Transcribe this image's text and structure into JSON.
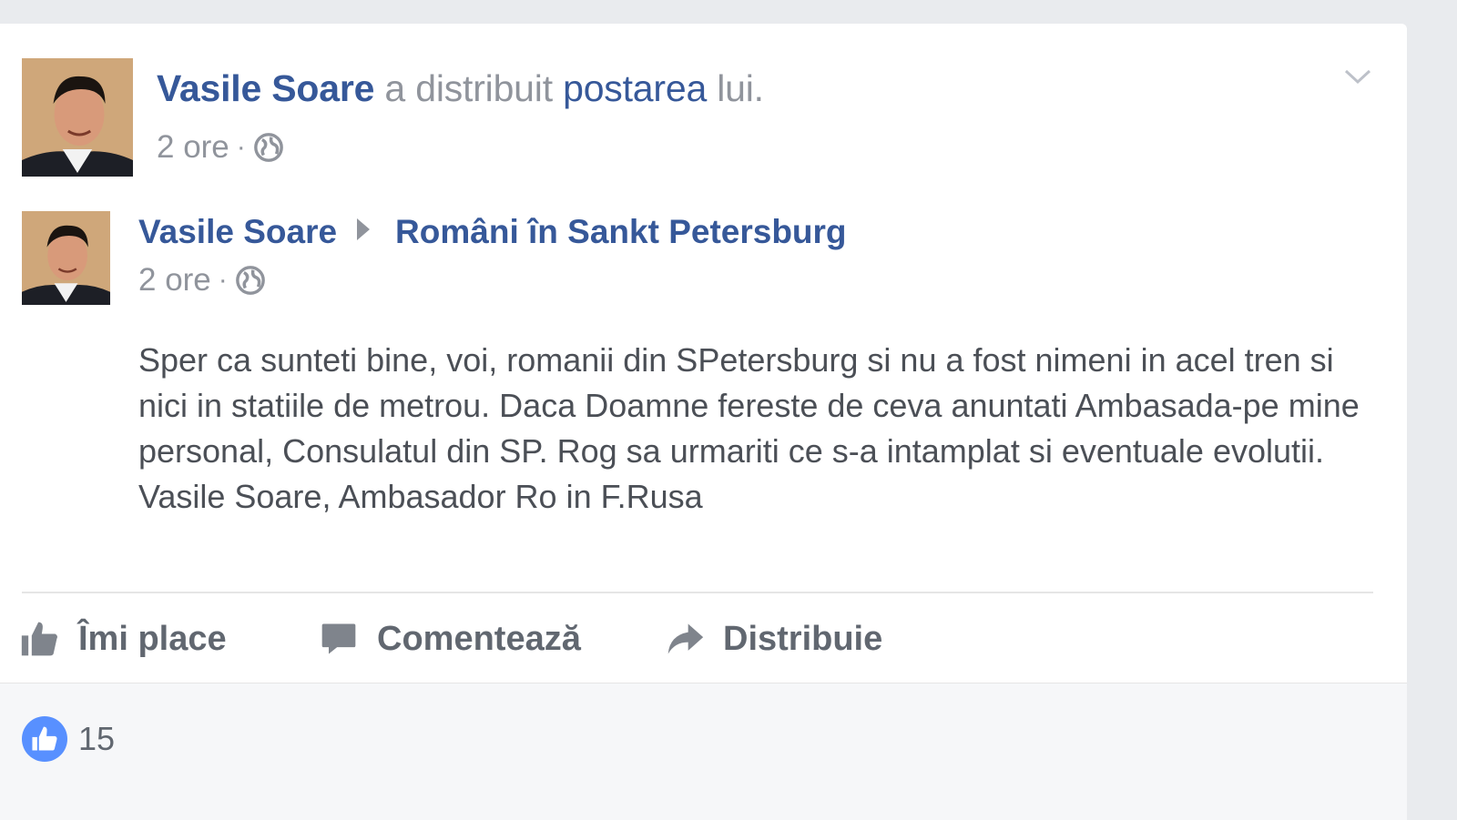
{
  "share_header": {
    "author": "Vasile Soare",
    "text_before": "a distribuit",
    "link_text": "postarea",
    "text_after": "lui.",
    "time": "2 ore",
    "separator": "·",
    "privacy_icon": "globe-icon"
  },
  "menu": {
    "icon": "chevron-down-icon"
  },
  "original_post": {
    "author": "Vasile Soare",
    "group": "Români în Sankt Petersburg",
    "time": "2 ore",
    "separator": "·",
    "privacy_icon": "globe-icon",
    "text": "Sper ca sunteti bine, voi, romanii din SPetersburg si nu a fost nimeni in acel tren si nici in statiile de metrou. Daca Doamne fereste de ceva anuntati Ambasada-pe mine personal, Consulatul din SP. Rog sa urmariti ce s-a intamplat si eventuale evolutii. Vasile Soare, Ambasador Ro in F.Rusa"
  },
  "actions": {
    "like": "Îmi place",
    "comment": "Comentează",
    "share": "Distribuie"
  },
  "reactions": {
    "icon": "like-badge-icon",
    "count": "15"
  },
  "colors": {
    "link": "#365899",
    "meta": "#90949c",
    "text": "#4b4f56",
    "action": "#616770",
    "like_blue": "#5890ff"
  }
}
